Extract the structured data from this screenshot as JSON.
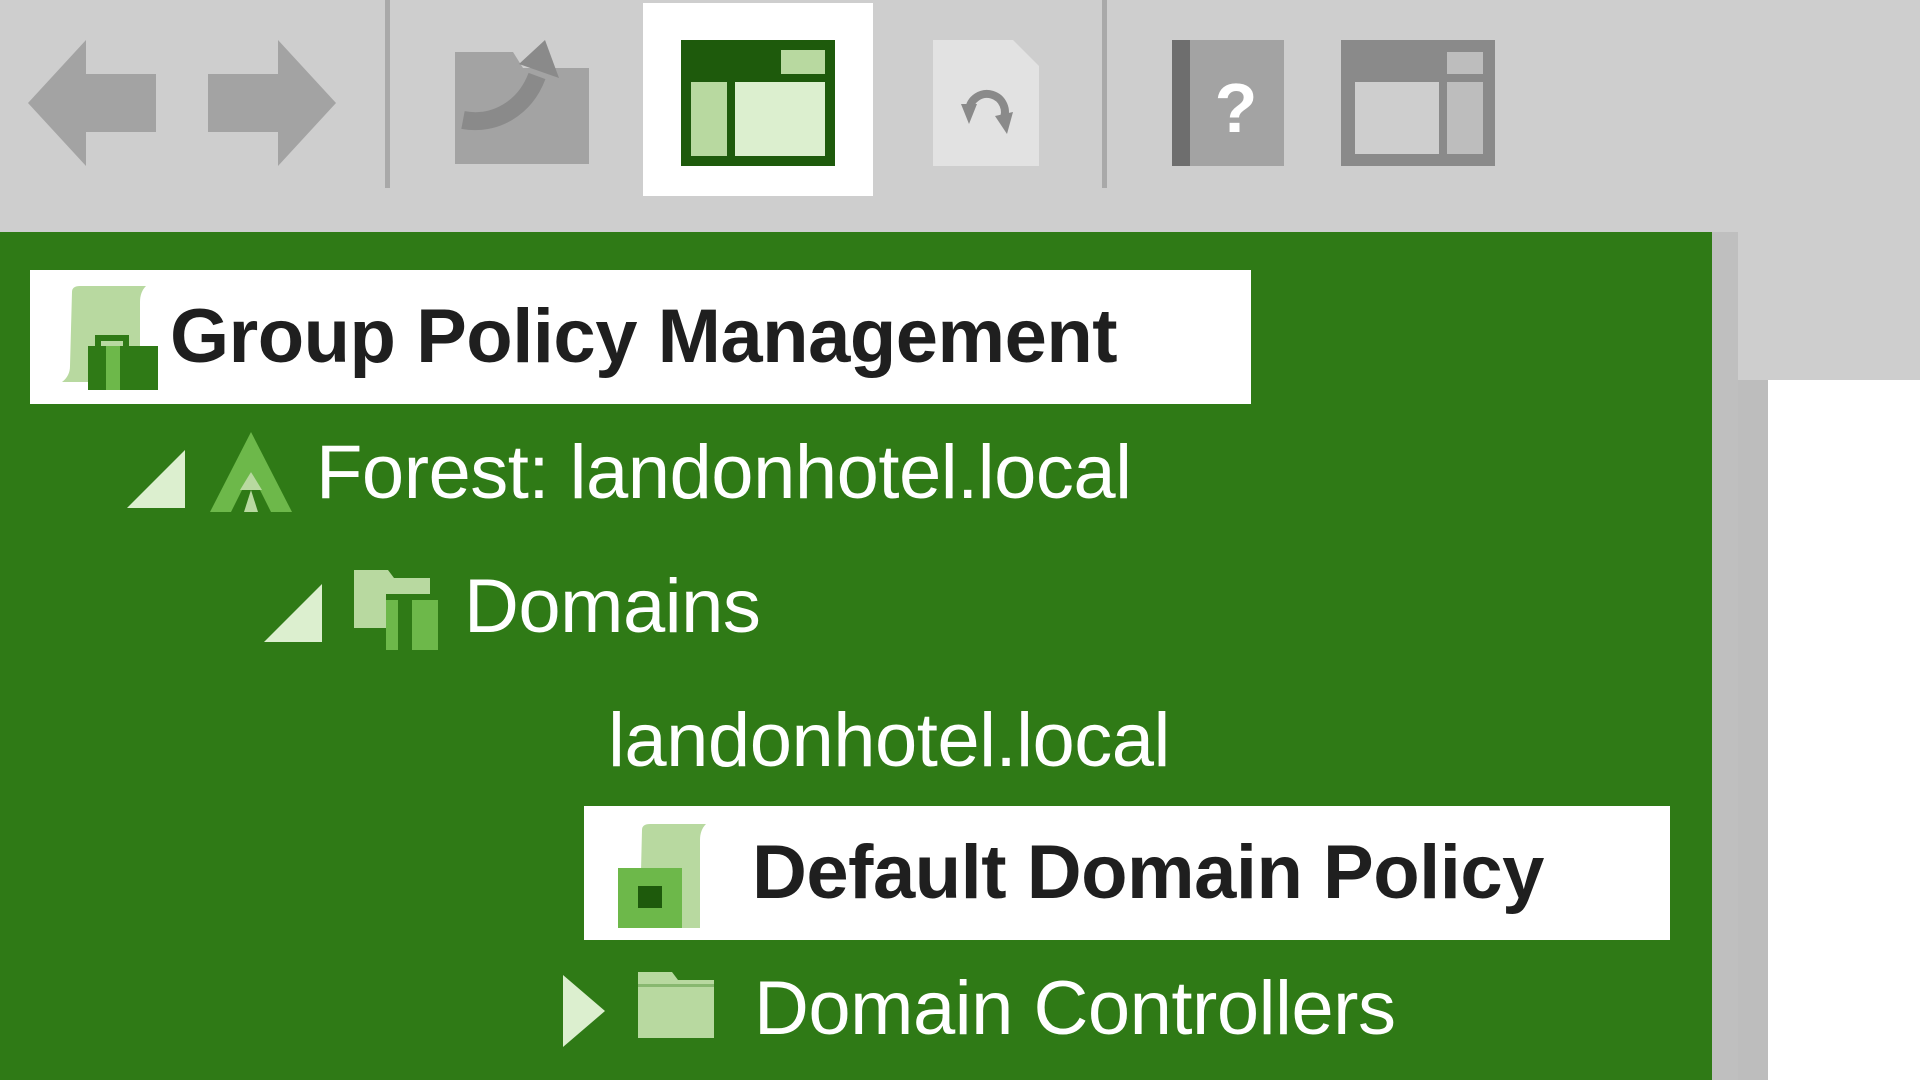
{
  "toolbar": {
    "buttons": [
      {
        "name": "back",
        "icon": "back-arrow-icon"
      },
      {
        "name": "forward",
        "icon": "forward-arrow-icon"
      },
      {
        "name": "up-one-level",
        "icon": "folder-up-icon"
      },
      {
        "name": "show-hide-console-tree",
        "icon": "console-tree-icon",
        "active": true
      },
      {
        "name": "refresh",
        "icon": "refresh-icon"
      },
      {
        "name": "help",
        "icon": "help-icon"
      },
      {
        "name": "show-hide-action-pane",
        "icon": "action-pane-icon"
      }
    ]
  },
  "tree": {
    "root": {
      "label": "Group Policy Management",
      "icon": "group-policy-icon",
      "selected": false
    },
    "forest": {
      "label": "Forest: landonhotel.local",
      "icon": "forest-icon",
      "expanded": true
    },
    "domains": {
      "label": "Domains",
      "icon": "domains-folder-icon",
      "expanded": true
    },
    "domain": {
      "label": "landonhotel.local",
      "icon": "domain-icon"
    },
    "default_policy": {
      "label": "Default Domain Policy",
      "icon": "gpo-link-icon",
      "selected": true
    },
    "domain_controllers": {
      "label": "Domain Controllers",
      "icon": "folder-icon",
      "expanded": false
    }
  },
  "colors": {
    "tree_background": "#2f7a16",
    "toolbar_background": "#cecece",
    "icon_gray": "#a3a3a3",
    "icon_green_dark": "#1e5a0c",
    "icon_green_light": "#b8d9a0"
  }
}
